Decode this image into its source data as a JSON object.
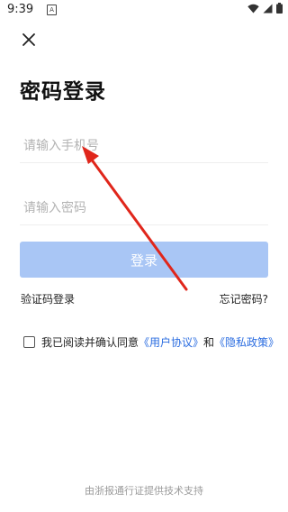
{
  "status_bar": {
    "time": "9:39",
    "notification_icon": "A"
  },
  "icons": {
    "close": "close-icon",
    "wifi": "wifi-icon",
    "signal": "signal-icon",
    "battery": "battery-icon"
  },
  "page": {
    "title": "密码登录"
  },
  "form": {
    "phone_placeholder": "请输入手机号",
    "password_placeholder": "请输入密码",
    "login_label": "登录"
  },
  "links": {
    "sms_login": "验证码登录",
    "forgot_password": "忘记密码?"
  },
  "agreement": {
    "prefix": "我已阅读并确认同意",
    "user_agreement": "《用户协议》",
    "and": "和",
    "privacy_policy": "《隐私政策》"
  },
  "footer": {
    "text": "由浙报通行证提供技术支持"
  },
  "colors": {
    "accent": "#2a6ce0",
    "button_disabled": "#a9c6f5",
    "annotation": "#e0261b"
  }
}
